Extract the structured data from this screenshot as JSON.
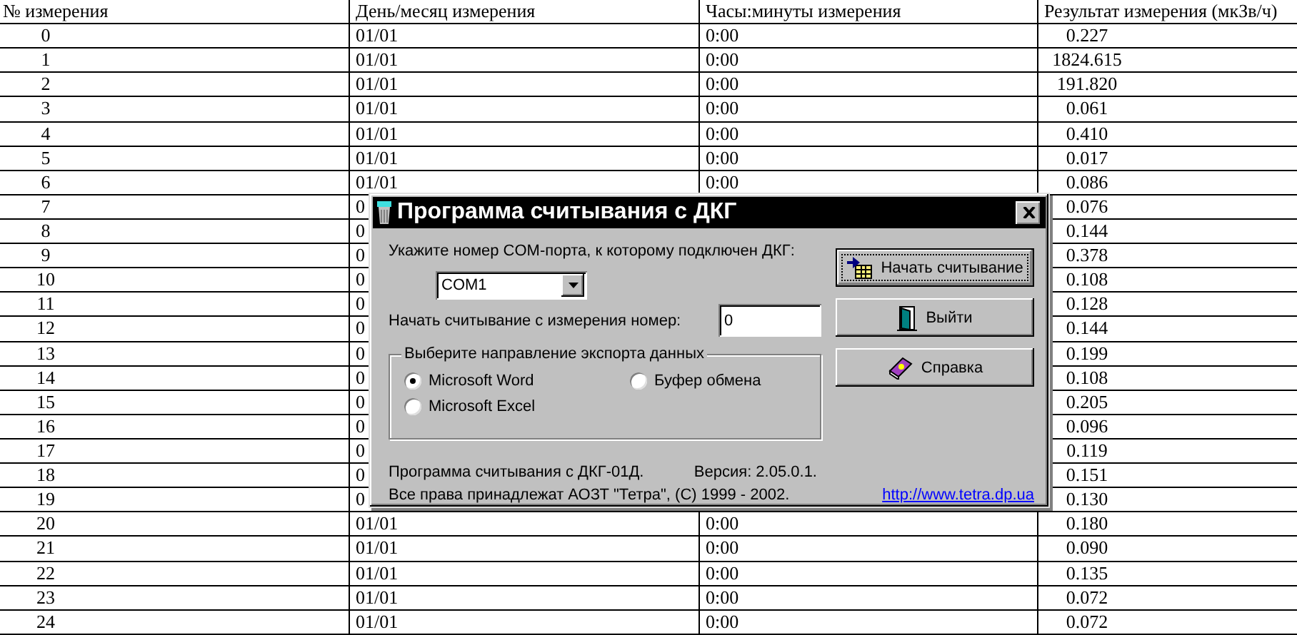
{
  "table": {
    "columns": [
      "№ измерения",
      "День/месяц измерения",
      "Часы:минуты измерения",
      "Результат измерения (мкЗв/ч)"
    ],
    "rows": [
      {
        "number": "0",
        "date": "01/01",
        "time": "0:00",
        "result": "0.227"
      },
      {
        "number": "1",
        "date": "01/01",
        "time": "0:00",
        "result": "1824.615"
      },
      {
        "number": "2",
        "date": "01/01",
        "time": "0:00",
        "result": "191.820"
      },
      {
        "number": "3",
        "date": "01/01",
        "time": "0:00",
        "result": "0.061"
      },
      {
        "number": "4",
        "date": "01/01",
        "time": "0:00",
        "result": "0.410"
      },
      {
        "number": "5",
        "date": "01/01",
        "time": "0:00",
        "result": "0.017"
      },
      {
        "number": "6",
        "date": "01/01",
        "time": "0:00",
        "result": "0.086"
      },
      {
        "number": "7",
        "date": "0",
        "result": "0.076"
      },
      {
        "number": "8",
        "date": "0",
        "result": "0.144"
      },
      {
        "number": "9",
        "date": "0",
        "result": "0.378"
      },
      {
        "number": "10",
        "date": "0",
        "result": "0.108"
      },
      {
        "number": "11",
        "date": "0",
        "result": "0.128"
      },
      {
        "number": "12",
        "date": "0",
        "result": "0.144"
      },
      {
        "number": "13",
        "date": "0",
        "result": "0.199"
      },
      {
        "number": "14",
        "date": "0",
        "result": "0.108"
      },
      {
        "number": "15",
        "date": "0",
        "result": "0.205"
      },
      {
        "number": "16",
        "date": "0",
        "result": "0.096"
      },
      {
        "number": "17",
        "date": "0",
        "result": "0.119"
      },
      {
        "number": "18",
        "date": "0",
        "result": "0.151"
      },
      {
        "number": "19",
        "date": "0",
        "result": "0.130"
      },
      {
        "number": "20",
        "date": "01/01",
        "time": "0:00",
        "result": "0.180"
      },
      {
        "number": "21",
        "date": "01/01",
        "time": "0:00",
        "result": "0.090"
      },
      {
        "number": "22",
        "date": "01/01",
        "time": "0:00",
        "result": "0.135"
      },
      {
        "number": "23",
        "date": "01/01",
        "time": "0:00",
        "result": "0.072"
      },
      {
        "number": "24",
        "date": "01/01",
        "time": "0:00",
        "result": "0.072"
      }
    ]
  },
  "dialog": {
    "title": "Программа считывания с ДКГ",
    "com_port_label": "Укажите номер COM-порта, к которому подключен ДКГ:",
    "com_port": {
      "value": "COM1"
    },
    "start_label": "Начать считывание с измерения номер:",
    "start_field": {
      "value": "0"
    },
    "export_group": {
      "title": "Выберите направление экспорта данных",
      "options": [
        {
          "label": "Microsoft Word",
          "selected": true
        },
        {
          "label": "Буфер обмена",
          "selected": false
        },
        {
          "label": "Microsoft Excel",
          "selected": false
        }
      ]
    },
    "program_info": "Программа считывания с ДКГ-01Д.",
    "version": "Версия: 2.05.0.1.",
    "copyright": "Все права принадлежат АОЗТ \"Тетра\", (C) 1999 - 2002.",
    "link": "http://www.tetra.dp.ua",
    "buttons": [
      {
        "label": "Начать считывание",
        "kind": "start",
        "default": true
      },
      {
        "label": "Выйти",
        "kind": "exit",
        "default": false
      },
      {
        "label": "Справка",
        "kind": "help",
        "default": false
      }
    ]
  }
}
